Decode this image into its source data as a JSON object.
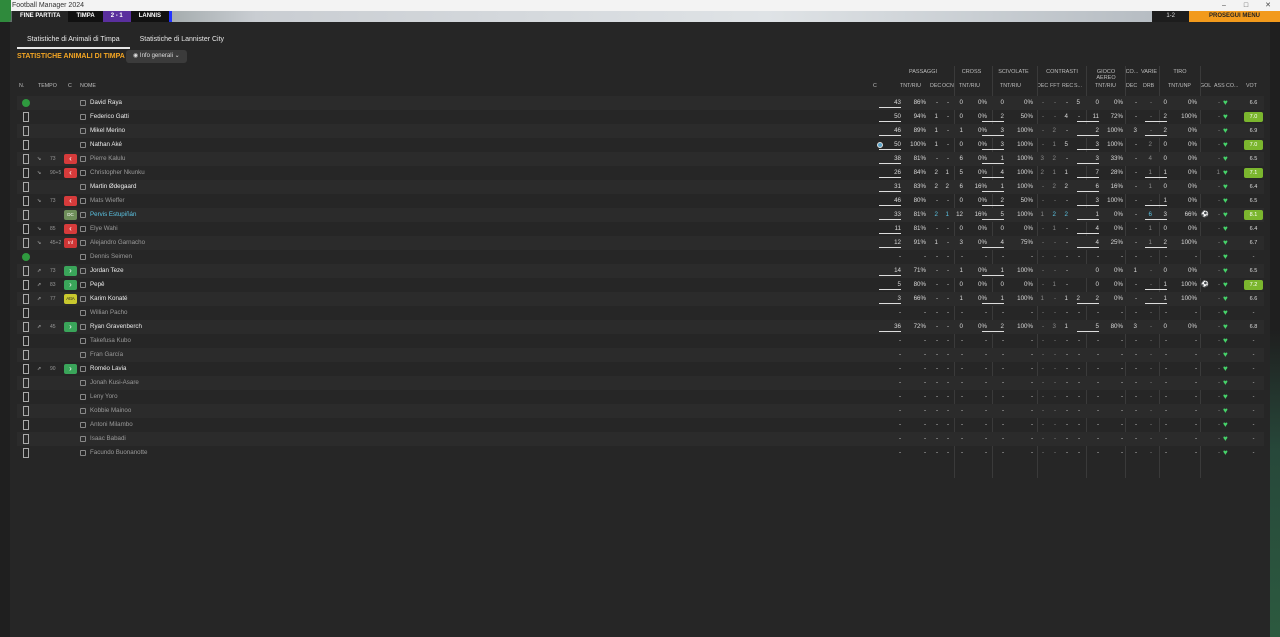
{
  "window": {
    "title": "Football Manager 2024",
    "minimize": "–",
    "maximize": "□",
    "close": "✕"
  },
  "match_bar": {
    "end_label": "FINE PARTITA",
    "home": "TIMPA",
    "score": "2 - 1",
    "away": "LANNIS",
    "right_score": "1-2",
    "advance": "PROSEGUI MENU"
  },
  "tabs": [
    {
      "label": "Statistiche di Animali di Timpa",
      "active": true
    },
    {
      "label": "Statistiche di Lannister City",
      "active": false
    }
  ],
  "section_title": "STATISTICHE ANIMALI DI TIMPA",
  "view_selector": {
    "label": "Info generali",
    "chevron": "⌄"
  },
  "groups": [
    {
      "label": "PASSAGGI"
    },
    {
      "label": "CROSS"
    },
    {
      "label": "SCIVOLATE"
    },
    {
      "label": "CONTRASTI"
    },
    {
      "label": "GIOCO AEREO"
    },
    {
      "label": "CO..."
    },
    {
      "label": "VARIE"
    },
    {
      "label": "TIRO"
    }
  ],
  "columns": {
    "n": "N.",
    "tempo": "TEMPO",
    "c": "C",
    "nome": "NOME",
    "c2": "C",
    "pass_tr": "TNT/RIU",
    "pass_dec": "DEC",
    "pass_occ": "OCN",
    "cross_tr": "TNT/RIU",
    "sciv_tr": "TNT/RIU",
    "con_dec": "DEC",
    "con_fft": "FFT",
    "con_rec": "REC",
    "con_s": "S...",
    "aer_tr": "TNT/RIU",
    "co_dec": "DEC",
    "drb": "DRB",
    "tiro": "TNT/UNP",
    "gol": "GOL",
    "ass": "ASS",
    "co2": "CO...",
    "vot": "VOT"
  },
  "players": [
    {
      "name": "David Raya",
      "status": "starter",
      "role_dot": true,
      "pass": [
        "43",
        "86%",
        "-",
        "-"
      ],
      "cross": [
        "0",
        "0%"
      ],
      "sciv": [
        "0",
        "0%"
      ],
      "con": [
        "-",
        "-",
        "-",
        "5"
      ],
      "aer": [
        "0",
        "0%"
      ],
      "co": "-",
      "drb": "-",
      "tiro": [
        "0",
        "0%"
      ],
      "gol": "",
      "ass": "-",
      "rating": "6.6",
      "good": false
    },
    {
      "name": "Federico Gatti",
      "status": "starter",
      "pass": [
        "50",
        "94%",
        "1",
        "-"
      ],
      "cross": [
        "0",
        "0%"
      ],
      "sciv": [
        "2",
        "50%"
      ],
      "con": [
        "-",
        "-",
        "4",
        "-"
      ],
      "aer": [
        "11",
        "72%"
      ],
      "co": "-",
      "drb": "-",
      "tiro": [
        "2",
        "100%"
      ],
      "gol": "",
      "ass": "-",
      "rating": "7.0",
      "good": true
    },
    {
      "name": "Mikel Merino",
      "status": "starter",
      "pass": [
        "46",
        "89%",
        "1",
        "-"
      ],
      "cross": [
        "1",
        "0%"
      ],
      "sciv": [
        "3",
        "100%"
      ],
      "con": [
        "-",
        "2",
        "-",
        ""
      ],
      "aer": [
        "2",
        "100%"
      ],
      "co": "3",
      "drb": "-",
      "tiro": [
        "2",
        "0%"
      ],
      "gol": "",
      "ass": "-",
      "rating": "6.9",
      "good": false
    },
    {
      "name": "Nathan Aké",
      "status": "starter",
      "c2dot": true,
      "pass": [
        "50",
        "100%",
        "1",
        "-"
      ],
      "cross": [
        "0",
        "0%"
      ],
      "sciv": [
        "3",
        "100%"
      ],
      "con": [
        "-",
        "1",
        "5",
        ""
      ],
      "aer": [
        "3",
        "100%"
      ],
      "co": "-",
      "drb": "2",
      "tiro": [
        "0",
        "0%"
      ],
      "gol": "",
      "ass": "-",
      "rating": "7.0",
      "good": true
    },
    {
      "name": "Pierre Kalulu",
      "status": "out",
      "time": "73",
      "pass": [
        "38",
        "81%",
        "-",
        "-"
      ],
      "cross": [
        "6",
        "0%"
      ],
      "sciv": [
        "1",
        "100%"
      ],
      "con": [
        "3",
        "2",
        "-",
        ""
      ],
      "aer": [
        "3",
        "33%"
      ],
      "co": "-",
      "drb": "4",
      "tiro": [
        "0",
        "0%"
      ],
      "gol": "",
      "ass": "-",
      "rating": "6.5",
      "good": false
    },
    {
      "name": "Christopher Nkunku",
      "status": "out",
      "time": "90+5",
      "pass": [
        "26",
        "84%",
        "2",
        "1"
      ],
      "cross": [
        "5",
        "0%"
      ],
      "sciv": [
        "4",
        "100%"
      ],
      "con": [
        "2",
        "1",
        "1",
        ""
      ],
      "aer": [
        "7",
        "28%"
      ],
      "co": "-",
      "drb": "1",
      "tiro": [
        "1",
        "0%"
      ],
      "gol": "",
      "ass": "1",
      "rating": "7.1",
      "good": true
    },
    {
      "name": "Martin Ødegaard",
      "status": "starter",
      "pass": [
        "31",
        "83%",
        "2",
        "2"
      ],
      "cross": [
        "6",
        "16%"
      ],
      "sciv": [
        "1",
        "100%"
      ],
      "con": [
        "-",
        "2",
        "2",
        ""
      ],
      "aer": [
        "6",
        "16%"
      ],
      "co": "-",
      "drb": "1",
      "tiro": [
        "0",
        "0%"
      ],
      "gol": "",
      "ass": "-",
      "rating": "6.4",
      "good": false
    },
    {
      "name": "Mats Wieffer",
      "status": "out",
      "time": "73",
      "pass": [
        "46",
        "80%",
        "-",
        "-"
      ],
      "cross": [
        "0",
        "0%"
      ],
      "sciv": [
        "2",
        "50%"
      ],
      "con": [
        "-",
        "-",
        "-",
        ""
      ],
      "aer": [
        "3",
        "100%"
      ],
      "co": "-",
      "drb": "-",
      "tiro": [
        "1",
        "0%"
      ],
      "gol": "",
      "ass": "-",
      "rating": "6.5",
      "good": false
    },
    {
      "name": "Pervis Estupiñán",
      "status": "highlight",
      "role": "DC",
      "pass": [
        "33",
        "81%",
        "2",
        "1"
      ],
      "cross": [
        "12",
        "16%"
      ],
      "sciv": [
        "5",
        "100%"
      ],
      "con": [
        "1",
        "2",
        "2",
        ""
      ],
      "aer": [
        "1",
        "0%"
      ],
      "co": "-",
      "drb": "6",
      "tiro": [
        "3",
        "66%"
      ],
      "gol": "⚽",
      "ass": "-",
      "rating": "8.1",
      "good": true
    },
    {
      "name": "Elye Wahi",
      "status": "out",
      "time": "85",
      "pass": [
        "11",
        "81%",
        "-",
        "-"
      ],
      "cross": [
        "0",
        "0%"
      ],
      "sciv": [
        "0",
        "0%"
      ],
      "con": [
        "-",
        "1",
        "-",
        ""
      ],
      "aer": [
        "4",
        "0%"
      ],
      "co": "-",
      "drb": "1",
      "tiro": [
        "0",
        "0%"
      ],
      "gol": "",
      "ass": "-",
      "rating": "6.4",
      "good": false
    },
    {
      "name": "Alejandro Garnacho",
      "status": "out",
      "time": "45+2",
      "role": "Inf",
      "pass": [
        "12",
        "91%",
        "1",
        "-"
      ],
      "cross": [
        "3",
        "0%"
      ],
      "sciv": [
        "4",
        "75%"
      ],
      "con": [
        "-",
        "-",
        "-",
        ""
      ],
      "aer": [
        "4",
        "25%"
      ],
      "co": "-",
      "drb": "1",
      "tiro": [
        "2",
        "100%"
      ],
      "gol": "",
      "ass": "-",
      "rating": "6.7",
      "good": false
    },
    {
      "name": "Dennis Seimen",
      "status": "bench",
      "role_dot": true,
      "pass": [
        "-",
        "-",
        "-",
        "-"
      ],
      "cross": [
        "-",
        "-"
      ],
      "sciv": [
        "-",
        "-"
      ],
      "con": [
        "-",
        "-",
        "-",
        "-"
      ],
      "aer": [
        "-",
        "-"
      ],
      "co": "-",
      "drb": "-",
      "tiro": [
        "-",
        "-"
      ],
      "gol": "",
      "ass": "-",
      "rating": "-",
      "good": false
    },
    {
      "name": "Jordan Teze",
      "status": "in",
      "time": "73",
      "pass": [
        "14",
        "71%",
        "-",
        "-"
      ],
      "cross": [
        "1",
        "0%"
      ],
      "sciv": [
        "1",
        "100%"
      ],
      "con": [
        "-",
        "-",
        "-",
        ""
      ],
      "aer": [
        "0",
        "0%"
      ],
      "co": "1",
      "drb": "-",
      "tiro": [
        "0",
        "0%"
      ],
      "gol": "",
      "ass": "-",
      "rating": "6.5",
      "good": false
    },
    {
      "name": "Pepê",
      "status": "in",
      "time": "83",
      "pass": [
        "5",
        "80%",
        "-",
        "-"
      ],
      "cross": [
        "0",
        "0%"
      ],
      "sciv": [
        "0",
        "0%"
      ],
      "con": [
        "-",
        "1",
        "-",
        ""
      ],
      "aer": [
        "0",
        "0%"
      ],
      "co": "-",
      "drb": "-",
      "tiro": [
        "1",
        "100%"
      ],
      "gol": "⚽",
      "ass": "-",
      "rating": "7.2",
      "good": true
    },
    {
      "name": "Karim Konaté",
      "status": "in",
      "time": "77",
      "role": "AttA",
      "pass": [
        "3",
        "66%",
        "-",
        "-"
      ],
      "cross": [
        "1",
        "0%"
      ],
      "sciv": [
        "1",
        "100%"
      ],
      "con": [
        "1",
        "-",
        "1",
        "2"
      ],
      "aer": [
        "2",
        "0%"
      ],
      "co": "-",
      "drb": "-",
      "tiro": [
        "1",
        "100%"
      ],
      "gol": "",
      "ass": "-",
      "rating": "6.6",
      "good": false
    },
    {
      "name": "Willian Pacho",
      "status": "bench",
      "pass": [
        "-",
        "-",
        "-",
        "-"
      ],
      "cross": [
        "-",
        "-"
      ],
      "sciv": [
        "-",
        "-"
      ],
      "con": [
        "-",
        "-",
        "-",
        "-"
      ],
      "aer": [
        "-",
        "-"
      ],
      "co": "-",
      "drb": "-",
      "tiro": [
        "-",
        "-"
      ],
      "gol": "",
      "ass": "-",
      "rating": "-",
      "good": false
    },
    {
      "name": "Ryan Gravenberch",
      "status": "in",
      "time": "45",
      "pass": [
        "36",
        "72%",
        "-",
        "-"
      ],
      "cross": [
        "0",
        "0%"
      ],
      "sciv": [
        "2",
        "100%"
      ],
      "con": [
        "-",
        "3",
        "1",
        ""
      ],
      "aer": [
        "5",
        "80%"
      ],
      "co": "3",
      "drb": "-",
      "tiro": [
        "0",
        "0%"
      ],
      "gol": "",
      "ass": "-",
      "rating": "6.8",
      "good": false
    },
    {
      "name": "Takefusa Kubo",
      "status": "bench",
      "pass": [
        "-",
        "-",
        "-",
        "-"
      ],
      "cross": [
        "-",
        "-"
      ],
      "sciv": [
        "-",
        "-"
      ],
      "con": [
        "-",
        "-",
        "-",
        "-"
      ],
      "aer": [
        "-",
        "-"
      ],
      "co": "-",
      "drb": "-",
      "tiro": [
        "-",
        "-"
      ],
      "gol": "",
      "ass": "-",
      "rating": "-",
      "good": false
    },
    {
      "name": "Fran García",
      "status": "bench",
      "pass": [
        "-",
        "-",
        "-",
        "-"
      ],
      "cross": [
        "-",
        "-"
      ],
      "sciv": [
        "-",
        "-"
      ],
      "con": [
        "-",
        "-",
        "-",
        "-"
      ],
      "aer": [
        "-",
        "-"
      ],
      "co": "-",
      "drb": "-",
      "tiro": [
        "-",
        "-"
      ],
      "gol": "",
      "ass": "-",
      "rating": "-",
      "good": false
    },
    {
      "name": "Roméo Lavia",
      "status": "in",
      "time": "90",
      "pass": [
        "-",
        "-",
        "-",
        "-"
      ],
      "cross": [
        "-",
        "-"
      ],
      "sciv": [
        "-",
        "-"
      ],
      "con": [
        "-",
        "-",
        "-",
        "-"
      ],
      "aer": [
        "-",
        "-"
      ],
      "co": "-",
      "drb": "-",
      "tiro": [
        "-",
        "-"
      ],
      "gol": "",
      "ass": "-",
      "rating": "-",
      "good": false
    },
    {
      "name": "Jonah Kusi-Asare",
      "status": "bench",
      "pass": [
        "-",
        "-",
        "-",
        "-"
      ],
      "cross": [
        "-",
        "-"
      ],
      "sciv": [
        "-",
        "-"
      ],
      "con": [
        "-",
        "-",
        "-",
        "-"
      ],
      "aer": [
        "-",
        "-"
      ],
      "co": "-",
      "drb": "-",
      "tiro": [
        "-",
        "-"
      ],
      "gol": "",
      "ass": "-",
      "rating": "-",
      "good": false
    },
    {
      "name": "Leny Yoro",
      "status": "bench",
      "pass": [
        "-",
        "-",
        "-",
        "-"
      ],
      "cross": [
        "-",
        "-"
      ],
      "sciv": [
        "-",
        "-"
      ],
      "con": [
        "-",
        "-",
        "-",
        "-"
      ],
      "aer": [
        "-",
        "-"
      ],
      "co": "-",
      "drb": "-",
      "tiro": [
        "-",
        "-"
      ],
      "gol": "",
      "ass": "-",
      "rating": "-",
      "good": false
    },
    {
      "name": "Kobbie Mainoo",
      "status": "bench",
      "pass": [
        "-",
        "-",
        "-",
        "-"
      ],
      "cross": [
        "-",
        "-"
      ],
      "sciv": [
        "-",
        "-"
      ],
      "con": [
        "-",
        "-",
        "-",
        "-"
      ],
      "aer": [
        "-",
        "-"
      ],
      "co": "-",
      "drb": "-",
      "tiro": [
        "-",
        "-"
      ],
      "gol": "",
      "ass": "-",
      "rating": "-",
      "good": false
    },
    {
      "name": "Antoni Milambo",
      "status": "bench",
      "pass": [
        "-",
        "-",
        "-",
        "-"
      ],
      "cross": [
        "-",
        "-"
      ],
      "sciv": [
        "-",
        "-"
      ],
      "con": [
        "-",
        "-",
        "-",
        "-"
      ],
      "aer": [
        "-",
        "-"
      ],
      "co": "-",
      "drb": "-",
      "tiro": [
        "-",
        "-"
      ],
      "gol": "",
      "ass": "-",
      "rating": "-",
      "good": false
    },
    {
      "name": "Isaac Babadi",
      "status": "bench",
      "pass": [
        "-",
        "-",
        "-",
        "-"
      ],
      "cross": [
        "-",
        "-"
      ],
      "sciv": [
        "-",
        "-"
      ],
      "con": [
        "-",
        "-",
        "-",
        "-"
      ],
      "aer": [
        "-",
        "-"
      ],
      "co": "-",
      "drb": "-",
      "tiro": [
        "-",
        "-"
      ],
      "gol": "",
      "ass": "-",
      "rating": "-",
      "good": false
    },
    {
      "name": "Facundo Buonanotte",
      "status": "bench",
      "pass": [
        "-",
        "-",
        "-",
        "-"
      ],
      "cross": [
        "-",
        "-"
      ],
      "sciv": [
        "-",
        "-"
      ],
      "con": [
        "-",
        "-",
        "-",
        "-"
      ],
      "aer": [
        "-",
        "-"
      ],
      "co": "-",
      "drb": "-",
      "tiro": [
        "-",
        "-"
      ],
      "gol": "",
      "ass": "-",
      "rating": "-",
      "good": false
    }
  ]
}
